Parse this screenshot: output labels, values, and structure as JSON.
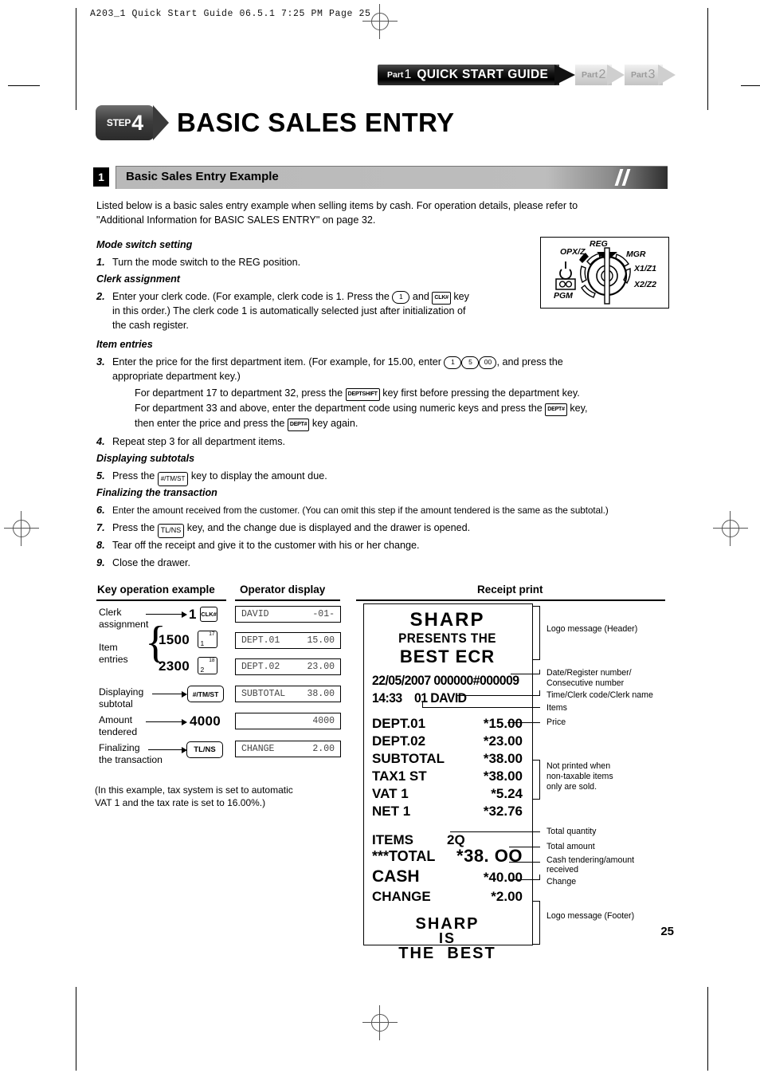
{
  "printer_marks": {
    "slugline": "A203_1 Quick Start Guide   06.5.1 7:25 PM  Page 25"
  },
  "part_tabs": [
    {
      "part_label": "Part",
      "number": "1",
      "title": "QUICK START GUIDE",
      "active": true
    },
    {
      "part_label": "Part",
      "number": "2",
      "title": "",
      "active": false
    },
    {
      "part_label": "Part",
      "number": "3",
      "title": "",
      "active": false
    }
  ],
  "step": {
    "word": "STEP",
    "number": "4",
    "title": "BASIC SALES ENTRY"
  },
  "section": {
    "number": "1",
    "title": "Basic Sales Entry Example"
  },
  "intro": {
    "line1": "Listed below is a basic sales entry example when selling items by cash.  For operation details, please refer to",
    "line2": "\"Additional Information for BASIC SALES ENTRY\" on page 32."
  },
  "procedure": {
    "h_mode": "Mode switch setting",
    "s1_num": "1.",
    "s1_text": "Turn the mode switch to the REG position.",
    "h_clerk": "Clerk assignment",
    "s2_num": "2.",
    "s2_a": "Enter your clerk code. (For example, clerk code is 1.  Press the",
    "s2_key1": "1",
    "s2_b": "and",
    "s2_key2": "CLK#",
    "s2_c": "key",
    "s2_line2": "in this order.)  The clerk code 1 is automatically selected just after initialization of",
    "s2_line3": "the cash register.",
    "h_item": "Item entries",
    "s3_num": "3.",
    "s3_a": "Enter the price for the first department item. (For example, for 15.00, enter",
    "s3_k1": "1",
    "s3_k2": "5",
    "s3_k3": "00",
    "s3_b": ", and press the",
    "s3_line2": "appropriate department key.)",
    "s3_line3_a": "For department 17 to department 32, press the",
    "s3_line3_key": "DEPTSHIFT",
    "s3_line3_b": "key first before pressing the department key.",
    "s3_line4_a": "For department 33 and above, enter the department code using numeric keys and press the",
    "s3_line4_key": "DEPT#",
    "s3_line4_b": "key,",
    "s3_line5_a": "then enter the price and press the",
    "s3_line5_key": "DEPT#",
    "s3_line5_b": "key again.",
    "s4_num": "4.",
    "s4_text": "Repeat step 3 for all department items.",
    "h_subtotal": "Displaying subtotals",
    "s5_num": "5.",
    "s5_a": "Press the",
    "s5_key": "#/TM/ST",
    "s5_b": "key to display the amount due.",
    "h_final": "Finalizing the transaction",
    "s6_num": "6.",
    "s6_text": "Enter the amount received from the customer.  (You can omit this step if the amount tendered is the same as the subtotal.)",
    "s7_num": "7.",
    "s7_a": "Press the",
    "s7_key": "TL/NS",
    "s7_b": "key, and the change due is displayed and the drawer is opened.",
    "s8_num": "8.",
    "s8_text": "Tear off the receipt and give it to the customer with his or her change.",
    "s9_num": "9.",
    "s9_text": "Close the drawer."
  },
  "mode_switch": {
    "labels": {
      "reg": "REG",
      "opxz": "OPX/Z",
      "mgr": "MGR",
      "x1z1": "X1/Z1",
      "x2z2": "X2/Z2",
      "pgm": "PGM"
    },
    "power_icon": "power-icon",
    "infinity_icon": "infinity-icon"
  },
  "key_table": {
    "col1_header": "Key operation example",
    "col2_header": "Operator display",
    "col3_header": "Receipt print",
    "rows": [
      {
        "label_l1": "Clerk",
        "label_l2": "assignment",
        "number": "1",
        "key": "CLK#",
        "key_type": "small",
        "display_left": "DAVID",
        "display_right": "-01-"
      },
      {
        "label_l1": "Item",
        "label_l2": "entries",
        "number": "1500",
        "key": "1",
        "key_sup": "17",
        "key_type": "dept",
        "display_left": "DEPT.01",
        "display_right": "15.00"
      },
      {
        "label_l1": "",
        "label_l2": "",
        "number": "2300",
        "key": "2",
        "key_sup": "18",
        "key_type": "dept",
        "display_left": "DEPT.02",
        "display_right": "23.00"
      },
      {
        "label_l1": "Displaying",
        "label_l2": "subtotal",
        "number": "",
        "key": "#/TM/ST",
        "key_type": "wide",
        "display_left": "SUBTOTAL",
        "display_right": "38.00"
      },
      {
        "label_l1": "Amount",
        "label_l2": "tendered",
        "number": "4000",
        "key": "",
        "key_type": "none",
        "display_left": "",
        "display_right": "4000"
      },
      {
        "label_l1": "Finalizing",
        "label_l2": "the transaction",
        "number": "",
        "key": "TL/NS",
        "key_type": "wide",
        "display_left": "CHANGE",
        "display_right": "2.00"
      }
    ]
  },
  "tax_note": {
    "line1": "(In this example, tax system is set to automatic",
    "line2": " VAT 1 and the tax rate is set to 16.00%.)"
  },
  "receipt": {
    "header": [
      "SHARP",
      "PRESENTS THE",
      "BEST ECR"
    ],
    "datetime_line1": "22/05/2007 000000#000009",
    "datetime_line2": "14:33    01 DAVID",
    "lines": [
      {
        "label": "DEPT.01",
        "value": "*15.00"
      },
      {
        "label": "DEPT.02",
        "value": "*23.00"
      },
      {
        "label": "SUBTOTAL",
        "value": "*38.00"
      },
      {
        "label": "TAX1 ST",
        "value": "*38.00"
      },
      {
        "label": "VAT 1",
        "value": "*5.24"
      },
      {
        "label": "NET 1",
        "value": "*32.76"
      }
    ],
    "items_label": "ITEMS",
    "items_qty": "2Q",
    "total_label": "***TOTAL",
    "total_value": "*38. OO",
    "cash_label": "CASH",
    "cash_value": "*40.00",
    "change_label": "CHANGE",
    "change_value": "*2.00",
    "footer": [
      "SHARP",
      "IS",
      "THE  BEST"
    ]
  },
  "annotations": [
    {
      "text": "Logo message (Header)"
    },
    {
      "text": "Date/Register number/"
    },
    {
      "text": "Consecutive number"
    },
    {
      "text": "Time/Clerk code/Clerk name"
    },
    {
      "text": "Items"
    },
    {
      "text": "Price"
    },
    {
      "text": "Not printed when"
    },
    {
      "text": "non-taxable items"
    },
    {
      "text": "only are sold."
    },
    {
      "text": "Total quantity"
    },
    {
      "text": "Total amount"
    },
    {
      "text": "Cash tendering/amount"
    },
    {
      "text": "received"
    },
    {
      "text": "Change"
    },
    {
      "text": "Logo message (Footer)"
    }
  ],
  "page_number": "25"
}
